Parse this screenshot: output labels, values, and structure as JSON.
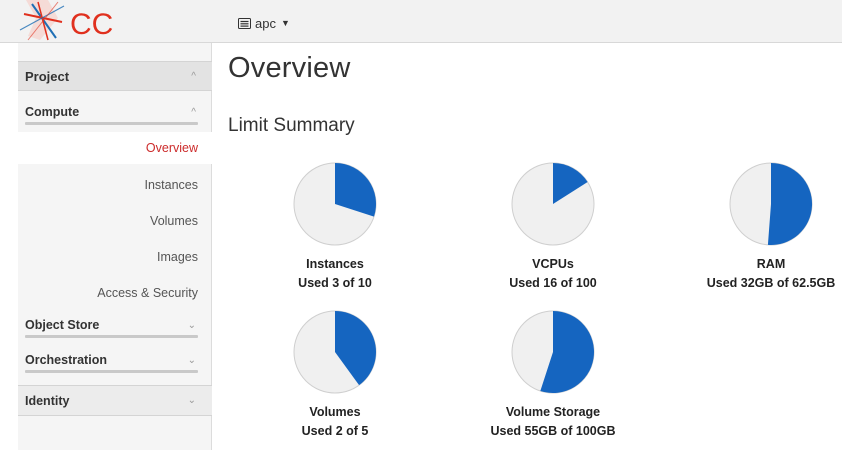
{
  "header": {
    "project_label": "apc",
    "logo_text": "CC"
  },
  "sidebar": {
    "project_header": "Project",
    "compute_header": "Compute",
    "compute_items": [
      {
        "label": "Overview",
        "active": true
      },
      {
        "label": "Instances",
        "active": false
      },
      {
        "label": "Volumes",
        "active": false
      },
      {
        "label": "Images",
        "active": false
      },
      {
        "label": "Access & Security",
        "active": false
      }
    ],
    "object_store_header": "Object Store",
    "orchestration_header": "Orchestration",
    "identity_header": "Identity"
  },
  "main": {
    "title": "Overview",
    "section_title": "Limit Summary",
    "quotas": [
      {
        "name": "Instances",
        "used_text": "Used 3 of 10",
        "fraction": 0.3
      },
      {
        "name": "VCPUs",
        "used_text": "Used 16 of 100",
        "fraction": 0.16
      },
      {
        "name": "RAM",
        "used_text": "Used 32GB of 62.5GB",
        "fraction": 0.512
      },
      {
        "name": "Volumes",
        "used_text": "Used 2 of 5",
        "fraction": 0.4
      },
      {
        "name": "Volume Storage",
        "used_text": "Used 55GB of 100GB",
        "fraction": 0.55
      }
    ]
  },
  "colors": {
    "pie_used": "#1565c0",
    "pie_free": "#f0f0f0",
    "pie_border": "#cfcfcf",
    "active_nav": "#cc2b2b",
    "logo_red": "#e0301e",
    "logo_blue": "#1f6fb5"
  },
  "icons": {
    "project_switch": "server-icon",
    "caret": "caret-down-icon",
    "collapse": "chevron-up-icon",
    "expand": "chevron-down-icon"
  }
}
